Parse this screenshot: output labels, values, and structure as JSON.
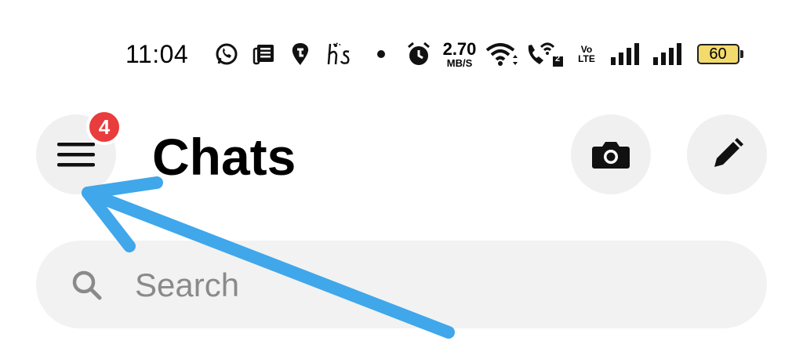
{
  "status_bar": {
    "time": "11:04",
    "net_speed_value": "2.70",
    "net_speed_unit": "MB/S",
    "volte_top": "Vo",
    "volte_bottom": "LTE",
    "sim2_label": "2",
    "battery_percent": "60",
    "battery_color": "#f3da6d",
    "icons": [
      "whatsapp-icon",
      "news-icon",
      "swiggy-icon",
      "hs-icon",
      "dot-icon",
      "alarm-icon",
      "wifi-icon",
      "wifi-call-icon",
      "signal-icon",
      "signal-icon"
    ]
  },
  "header": {
    "title": "Chats",
    "menu_badge": "4",
    "badge_color": "#e93c3c"
  },
  "search": {
    "placeholder": "Search"
  },
  "annotation": {
    "arrow_color": "#3fa7ea"
  }
}
